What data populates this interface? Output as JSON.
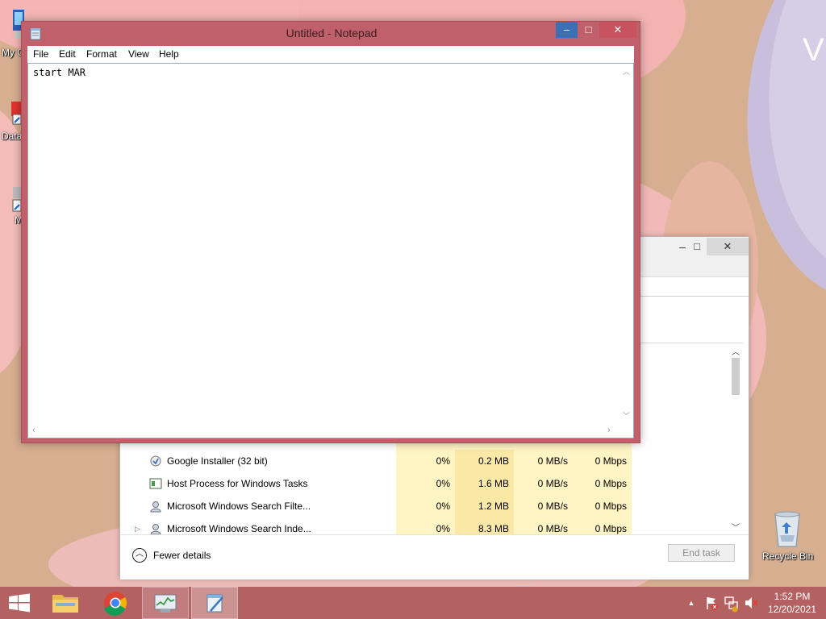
{
  "desktop": {
    "icons": [
      {
        "label": "My C"
      },
      {
        "label": "Data"
      },
      {
        "label": "M"
      }
    ],
    "wallpaper_text": "V",
    "recycle_bin": {
      "label": "Recycle Bin"
    }
  },
  "notepad": {
    "title": "Untitled - Notepad",
    "caption_buttons": {
      "minimize": "–",
      "maximize": "□",
      "close": "✕"
    },
    "menu": [
      "File",
      "Edit",
      "Format",
      "View",
      "Help"
    ],
    "content": "start MAR"
  },
  "task_manager": {
    "caption_buttons": {
      "maximize": "□",
      "close": "✕"
    },
    "processes": [
      {
        "name": "Google Installer (32 bit)",
        "cpu": "0%",
        "memory": "0.2 MB",
        "disk": "0 MB/s",
        "network": "0 Mbps",
        "icon": "installer-icon",
        "expandable": false
      },
      {
        "name": "Host Process for Windows Tasks",
        "cpu": "0%",
        "memory": "1.6 MB",
        "disk": "0 MB/s",
        "network": "0 Mbps",
        "icon": "host-process-icon",
        "expandable": false
      },
      {
        "name": "Microsoft Windows Search Filte...",
        "cpu": "0%",
        "memory": "1.2 MB",
        "disk": "0 MB/s",
        "network": "0 Mbps",
        "icon": "search-filter-icon",
        "expandable": false
      },
      {
        "name": "Microsoft Windows Search Inde...",
        "cpu": "0%",
        "memory": "8.3 MB",
        "disk": "0 MB/s",
        "network": "0 Mbps",
        "icon": "search-indexer-icon",
        "expandable": true
      }
    ],
    "fewer_details": "Fewer details",
    "end_task": "End task"
  },
  "taskbar": {
    "start": "start-icon",
    "pinned": [
      "file-explorer-icon",
      "chrome-icon",
      "task-manager-icon",
      "notepad-icon"
    ],
    "clock": {
      "time": "1:52 PM",
      "date": "12/20/2021"
    }
  },
  "colors": {
    "taskbar": "#b05a5c",
    "notepad_frame": "#c0606a",
    "minimize_button": "#3b6fb6",
    "cpu_column": "#fff4c4"
  }
}
